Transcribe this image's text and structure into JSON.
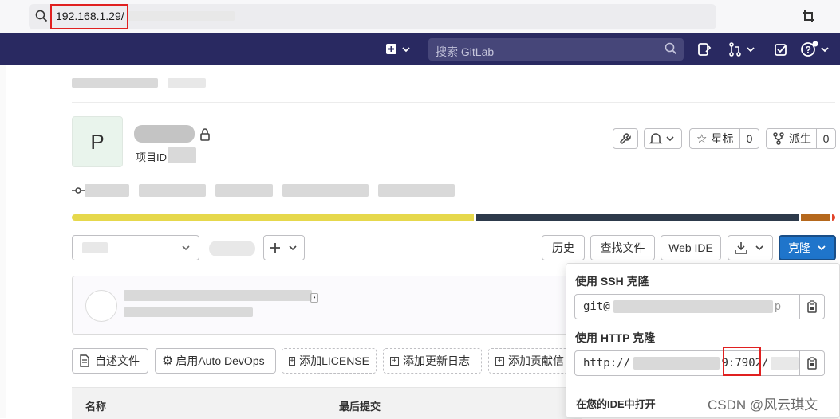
{
  "browser": {
    "url": "192.168.1.29/"
  },
  "header": {
    "search_placeholder": "搜索 GitLab"
  },
  "project": {
    "avatar_letter": "P",
    "id_label": "项目ID",
    "star_label": "星标",
    "star_count": "0",
    "fork_label": "派生",
    "fork_count": "0"
  },
  "toolbar": {
    "history_label": "历史",
    "find_file_label": "查找文件",
    "web_ide_label": "Web IDE",
    "clone_label": "克隆"
  },
  "actions": {
    "readme_label": "自述文件",
    "auto_devops_label": "启用Auto DevOps",
    "add_license_label": "添加LICENSE",
    "add_changelog_label": "添加更新日志",
    "add_contributing_label": "添加贡献信"
  },
  "table": {
    "col_name": "名称",
    "col_last_commit": "最后提交"
  },
  "clone": {
    "ssh_title": "使用 SSH 克隆",
    "ssh_prefix": "git@",
    "ssh_suffix": "p",
    "http_title": "使用 HTTP 克隆",
    "http_prefix": "http://",
    "http_port": "9:7902/",
    "open_in_ide_title": "在您的IDE中打开"
  },
  "watermark": "CSDN @风云琪文",
  "colors": {
    "header_bg": "#292961",
    "primary": "#1f75cb",
    "highlight_red": "#e02020",
    "lang_bar": [
      "#e6d84c",
      "#2d3a4b",
      "#b5681d",
      "#e24329"
    ]
  }
}
